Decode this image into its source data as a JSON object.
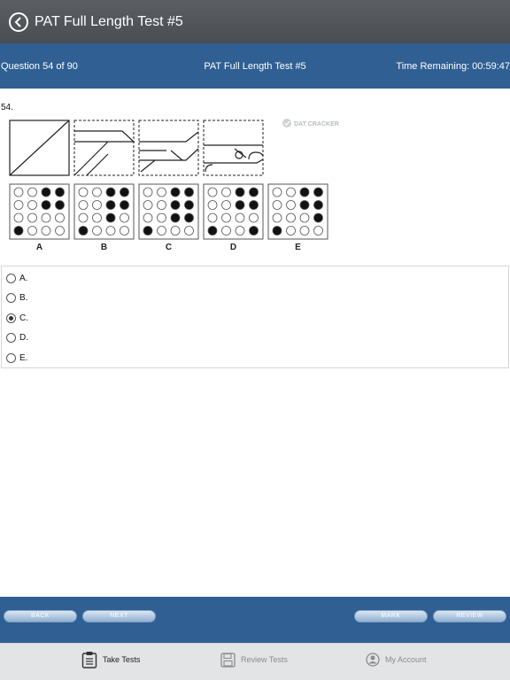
{
  "header": {
    "title": "PAT Full Length Test #5"
  },
  "info": {
    "question_count": "Question 54 of 90",
    "test_name": "PAT Full Length Test #5",
    "time_remaining": "Time Remaining: 00:59:47"
  },
  "question": {
    "number": "54.",
    "watermark": "DAT CRACKER",
    "grid_labels": [
      "A",
      "B",
      "C",
      "D",
      "E"
    ],
    "grids": [
      [
        [
          0,
          0,
          1,
          1
        ],
        [
          0,
          0,
          1,
          1
        ],
        [
          0,
          0,
          0,
          0
        ],
        [
          1,
          0,
          0,
          0
        ]
      ],
      [
        [
          0,
          0,
          1,
          1
        ],
        [
          0,
          0,
          1,
          1
        ],
        [
          0,
          0,
          1,
          0
        ],
        [
          1,
          0,
          0,
          0
        ]
      ],
      [
        [
          0,
          0,
          1,
          1
        ],
        [
          0,
          0,
          1,
          1
        ],
        [
          0,
          0,
          1,
          1
        ],
        [
          1,
          0,
          0,
          0
        ]
      ],
      [
        [
          0,
          0,
          1,
          1
        ],
        [
          0,
          0,
          1,
          1
        ],
        [
          0,
          0,
          0,
          0
        ],
        [
          1,
          0,
          0,
          1
        ]
      ],
      [
        [
          0,
          0,
          1,
          1
        ],
        [
          0,
          0,
          1,
          1
        ],
        [
          0,
          0,
          0,
          1
        ],
        [
          1,
          0,
          0,
          0
        ]
      ]
    ]
  },
  "choices": [
    {
      "label": "A.",
      "selected": false
    },
    {
      "label": "B.",
      "selected": false
    },
    {
      "label": "C.",
      "selected": true
    },
    {
      "label": "D.",
      "selected": false
    },
    {
      "label": "E.",
      "selected": false
    }
  ],
  "actions": {
    "back": "BACK",
    "next": "NEXT",
    "mark": "MARK",
    "review": "REVIEW"
  },
  "tabs": [
    {
      "label": "Take Tests",
      "icon": "clipboard-icon",
      "active": true
    },
    {
      "label": "Review Tests",
      "icon": "floppy-disk-icon",
      "active": false
    },
    {
      "label": "My Account",
      "icon": "user-circle-icon",
      "active": false
    }
  ]
}
